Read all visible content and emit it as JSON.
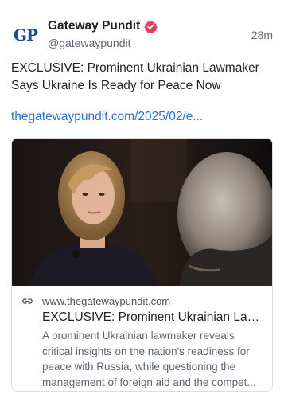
{
  "author": {
    "avatar_text_1": "G",
    "avatar_text_2": "P",
    "display_name": "Gateway Pundit",
    "handle": "@gatewaypundit",
    "verified_color": "#e83e5d"
  },
  "timestamp": "28m",
  "post": {
    "text": "EXCLUSIVE: Prominent Ukrainian Lawmaker Says Ukraine Is Ready for Peace Now",
    "link_text": "thegatewaypundit.com/2025/02/e..."
  },
  "link_card": {
    "domain": "www.thegatewaypundit.com",
    "title": "EXCLUSIVE: Prominent Ukrainian Law...",
    "description": "A prominent Ukrainian lawmaker reveals critical insights on the nation's readiness for peace with Russia, while questioning the management of foreign aid and the compet..."
  },
  "colors": {
    "link": "#2e71c9",
    "text": "#1f2328",
    "muted": "#5f6671"
  }
}
